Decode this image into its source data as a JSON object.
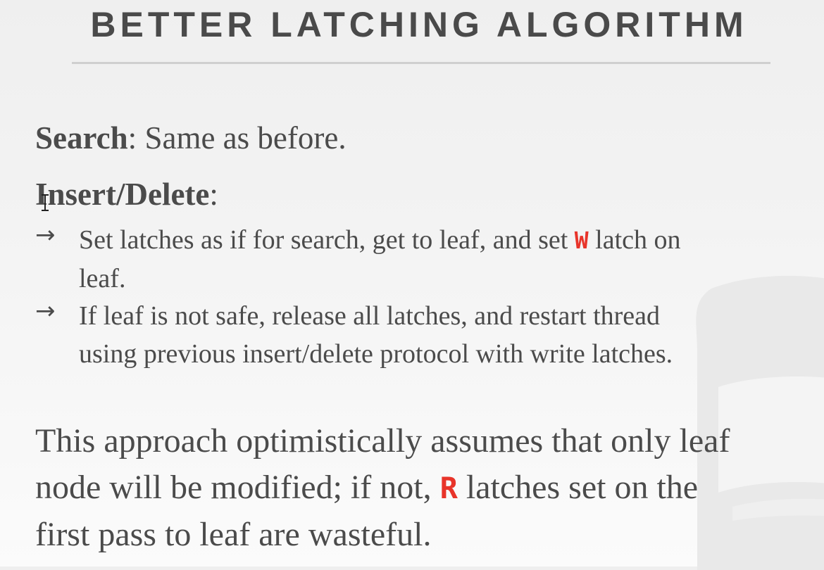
{
  "title": "BETTER LATCHING ALGORITHM",
  "search": {
    "label": "Search",
    "colon": ":",
    "text": " Same as before."
  },
  "insert_delete": {
    "label": "Insert/Delete",
    "colon": ":"
  },
  "bullets": [
    {
      "arrow": "→",
      "before": "Set latches as if for search, get to leaf, and set ",
      "latch": "W",
      "after_line1": " latch on",
      "after_line2": "leaf."
    },
    {
      "arrow": "→",
      "line1": "If leaf is not safe, release all latches, and restart thread",
      "line2": "using previous insert/delete protocol with write latches."
    }
  ],
  "summary": {
    "line1": "This approach optimistically assumes that only leaf",
    "line2_before": "node will be modified; if not, ",
    "latch": "R",
    "line2_after": " latches set on the",
    "line3": "first pass to leaf are wasteful."
  },
  "colors": {
    "latch_accent": "#e8342a",
    "text": "#4b4b4b",
    "title_rule": "#cfcfcf"
  },
  "icons": [
    "text-cursor-icon",
    "watermark-logo"
  ]
}
